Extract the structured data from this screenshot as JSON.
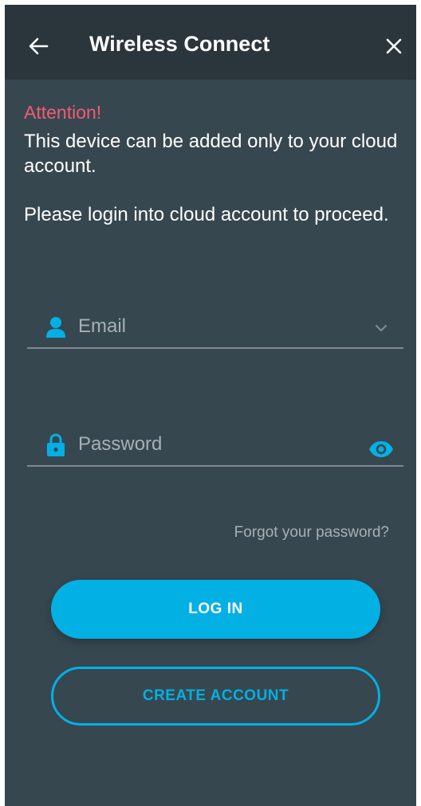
{
  "header": {
    "title": "Wireless Connect",
    "back_icon": "arrow-left-icon",
    "close_icon": "close-icon"
  },
  "notice": {
    "attention": "Attention!",
    "line1": "This device can be added only to your cloud account.",
    "line2": "Please login into cloud account to proceed."
  },
  "form": {
    "email_placeholder": "Email",
    "email_value": "",
    "password_placeholder": "Password",
    "password_value": "",
    "forgot_label": "Forgot your password?"
  },
  "actions": {
    "login_label": "LOG IN",
    "create_label": "CREATE ACCOUNT"
  },
  "colors": {
    "background": "#37474f",
    "header": "#2a363c",
    "accent": "#03b0e4",
    "attention": "#f25b73",
    "muted": "#a7b0b5"
  }
}
